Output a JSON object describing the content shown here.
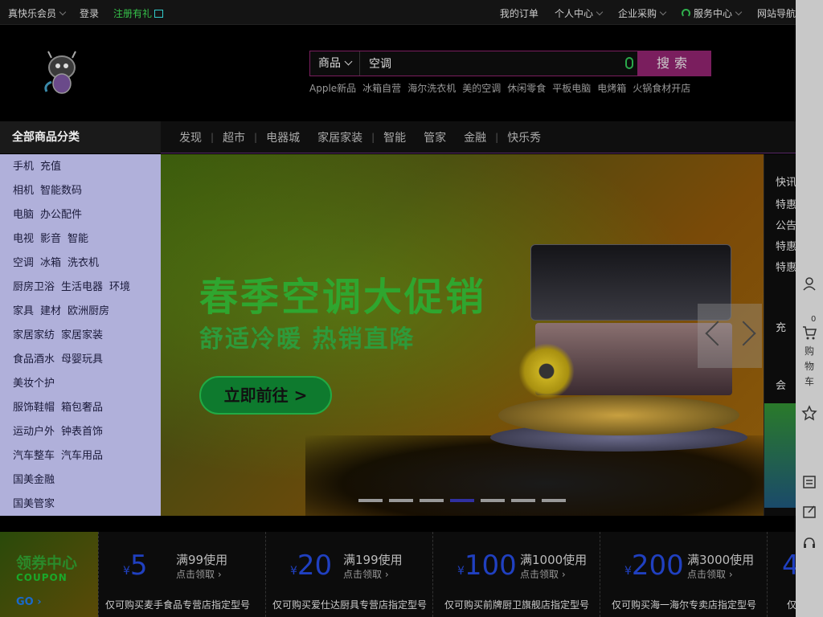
{
  "topbar": {
    "member": "真快乐会员",
    "login": "登录",
    "register": "注册有礼",
    "my_orders": "我的订单",
    "personal_center": "个人中心",
    "enterprise": "企业采购",
    "service": "服务中心",
    "site_nav": "网站导航"
  },
  "search": {
    "category": "商品",
    "value": "空调",
    "button": "搜索",
    "hotwords": [
      "Apple新品",
      "冰箱自营",
      "海尔洗衣机",
      "美的空调",
      "休闲零食",
      "平板电脑",
      "电烤箱",
      "火锅食材开店"
    ]
  },
  "nav": {
    "all_categories": "全部商品分类",
    "links": [
      "发现",
      "超市",
      "电器城",
      "家居家装",
      "智能",
      "管家",
      "金融",
      "快乐秀"
    ]
  },
  "categories": [
    [
      "手机",
      "充值"
    ],
    [
      "相机",
      "智能数码"
    ],
    [
      "电脑",
      "办公配件"
    ],
    [
      "电视",
      "影音",
      "智能"
    ],
    [
      "空调",
      "冰箱",
      "洗衣机"
    ],
    [
      "厨房卫浴",
      "生活电器",
      "环境"
    ],
    [
      "家具",
      "建材",
      "欧洲厨房"
    ],
    [
      "家居家纺",
      "家居家装"
    ],
    [
      "食品酒水",
      "母婴玩具"
    ],
    [
      "美妆个护"
    ],
    [
      "服饰鞋帽",
      "箱包奢品"
    ],
    [
      "运动户外",
      "钟表首饰"
    ],
    [
      "汽车整车",
      "汽车用品"
    ],
    [
      "国美金融"
    ],
    [
      "国美管家"
    ]
  ],
  "banner": {
    "title": "春季空调大促销",
    "subtitle": "舒适冷暖  热销直降",
    "cta": "立即前往 >",
    "slide_count": 7,
    "active_slide": 3
  },
  "news": {
    "items": [
      "快讯",
      "特惠",
      "公告",
      "特惠",
      "特惠"
    ],
    "recharge": "充",
    "member_short": "会"
  },
  "toolbar": {
    "cart_count": "0",
    "cart_label": "购物车"
  },
  "coupons": {
    "center": {
      "title": "领券中心",
      "en": "COUPON",
      "go": "GO ›"
    },
    "items": [
      {
        "currency": "¥",
        "amount": "5",
        "condition": "满99使用",
        "action": "点击领取 ›",
        "desc": "仅可购买麦手食品专营店指定型号"
      },
      {
        "currency": "¥",
        "amount": "20",
        "condition": "满199使用",
        "action": "点击领取 ›",
        "desc": "仅可购买爱仕达厨具专营店指定型号"
      },
      {
        "currency": "¥",
        "amount": "100",
        "condition": "满1000使用",
        "action": "点击领取 ›",
        "desc": "仅可购买前牌厨卫旗舰店指定型号"
      },
      {
        "currency": "¥",
        "amount": "200",
        "condition": "满3000使用",
        "action": "点击领取 ›",
        "desc": "仅可购买海一海尔专卖店指定型号"
      },
      {
        "currency": "¥",
        "amount": "4",
        "condition": "",
        "action": "",
        "desc": "仅"
      }
    ]
  },
  "colors": {
    "accent": "#7a1e5e",
    "green": "#36c24a",
    "category_bg": "#b0b0da",
    "toolbar_bg": "#c8c8c8"
  }
}
